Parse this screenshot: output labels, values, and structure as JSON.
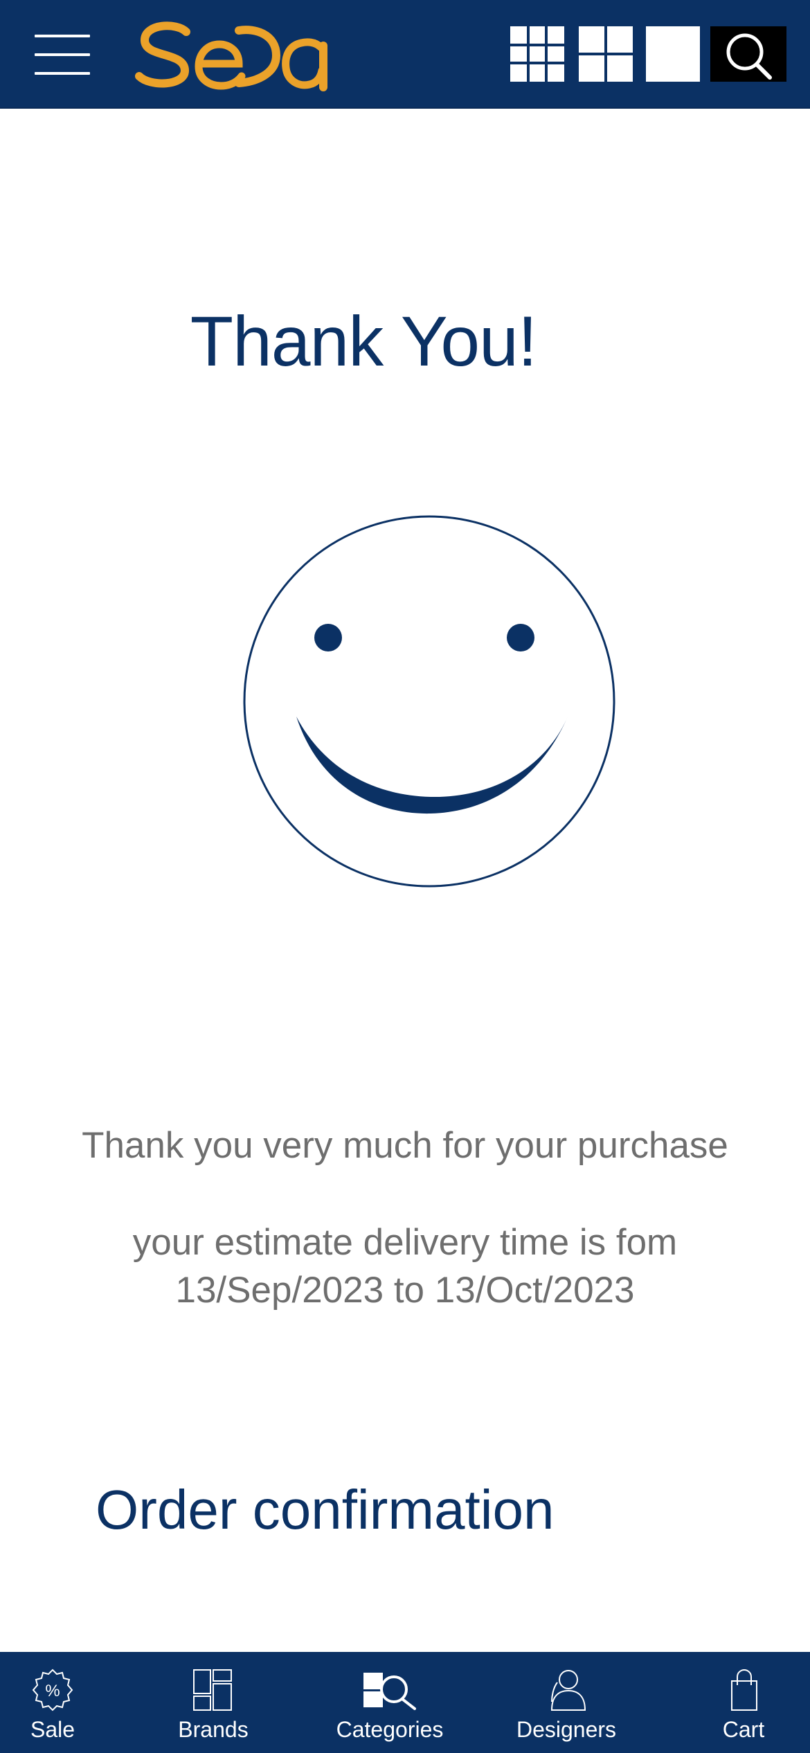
{
  "header": {
    "logo_text": "SeDa",
    "menu_icon": "hamburger-menu-icon",
    "view_options": [
      "grid-9-icon",
      "grid-4-icon",
      "grid-1-icon"
    ],
    "search_icon": "search-icon",
    "colors": {
      "brand": "#0b3164",
      "logo": "#eba22a"
    }
  },
  "main": {
    "title": "Thank You!",
    "smiley_icon": "smiley-face-icon",
    "message_line1": "Thank you very much for your purchase",
    "message_line2": "your estimate delivery time is fom",
    "message_line3": "13/Sep/2023 to 13/Oct/2023",
    "order_link": "Order confirmation"
  },
  "bottom_nav": {
    "items": [
      {
        "label": "Sale",
        "icon": "sale-badge-icon"
      },
      {
        "label": "Brands",
        "icon": "brands-icon"
      },
      {
        "label": "Categories",
        "icon": "categories-search-icon"
      },
      {
        "label": "Designers",
        "icon": "designers-icon"
      },
      {
        "label": "Cart",
        "icon": "shopping-bag-icon"
      }
    ]
  }
}
